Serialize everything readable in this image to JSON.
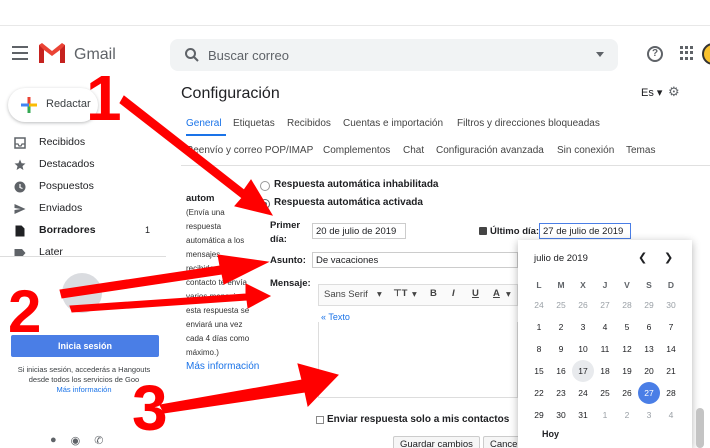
{
  "app": {
    "logo_text": "Gmail",
    "search_placeholder": "Buscar correo",
    "help_symbol": "?"
  },
  "sidebar": {
    "compose_label": "Redactar",
    "items": [
      {
        "label": "Recibidos",
        "icon": "inbox-icon",
        "count": ""
      },
      {
        "label": "Destacados",
        "icon": "star-icon",
        "count": ""
      },
      {
        "label": "Pospuestos",
        "icon": "clock-icon",
        "count": ""
      },
      {
        "label": "Enviados",
        "icon": "send-icon",
        "count": ""
      },
      {
        "label": "Borradores",
        "icon": "draft-icon",
        "count": "1"
      },
      {
        "label": "Later",
        "icon": "label-icon",
        "count": ""
      }
    ]
  },
  "hangouts": {
    "login_button": "Inicia sesión",
    "info_line1": "Si inicias sesión, accederás a Hangouts",
    "info_line2": "desde todos los servicios de Goo",
    "more_info": "Más información"
  },
  "settings": {
    "title": "Configuración",
    "lang": "Es",
    "tabs_row1": [
      "General",
      "Etiquetas",
      "Recibidos",
      "Cuentas e importación",
      "Filtros y direcciones bloqueadas"
    ],
    "tabs_row2": [
      "Reenvío y correo POP/IMAP",
      "Complementos",
      "Chat",
      "Configuración avanzada",
      "Sin conexión",
      "Temas"
    ],
    "vacation": {
      "section_label": "autom",
      "help_lines": [
        "(Envía una",
        "respuesta",
        "automática a los",
        "mensajes",
        "recibidos. Si un",
        "contacto te envía",
        "varios mensajes,",
        "esta respuesta se",
        "enviará una vez",
        "cada 4 días como",
        "máximo.)"
      ],
      "more_info": "Más información",
      "option_off": "Respuesta automática inhabilitada",
      "option_on": "Respuesta automática activada",
      "first_day_label_1": "Primer",
      "first_day_label_2": "día:",
      "first_day_value": "20 de julio de 2019",
      "last_day_label": "Último día:",
      "last_day_value": "27 de julio de 2019",
      "subject_label": "Asunto:",
      "subject_value": "De vacaciones",
      "message_label": "Mensaje:",
      "font_name": "Sans Serif",
      "texto_link": "« Texto",
      "contacts_only": "Enviar respuesta solo a mis contactos"
    },
    "save_button": "Guardar cambios",
    "cancel_button": "Cance"
  },
  "calendar": {
    "month": "julio de 2019",
    "day_headers": [
      "L",
      "M",
      "X",
      "J",
      "V",
      "S",
      "D"
    ],
    "weeks": [
      [
        "24",
        "25",
        "26",
        "27",
        "28",
        "29",
        "30"
      ],
      [
        "1",
        "2",
        "3",
        "4",
        "5",
        "6",
        "7"
      ],
      [
        "8",
        "9",
        "10",
        "11",
        "12",
        "13",
        "14"
      ],
      [
        "15",
        "16",
        "17",
        "18",
        "19",
        "20",
        "21"
      ],
      [
        "22",
        "23",
        "24",
        "25",
        "26",
        "27",
        "28"
      ],
      [
        "29",
        "30",
        "31",
        "1",
        "2",
        "3",
        "4"
      ]
    ],
    "today": "17",
    "selected": "27",
    "today_button": "Hoy"
  },
  "annotations": {
    "numbers": [
      "1",
      "2",
      "3"
    ],
    "arrow_color": "#ff0000"
  }
}
